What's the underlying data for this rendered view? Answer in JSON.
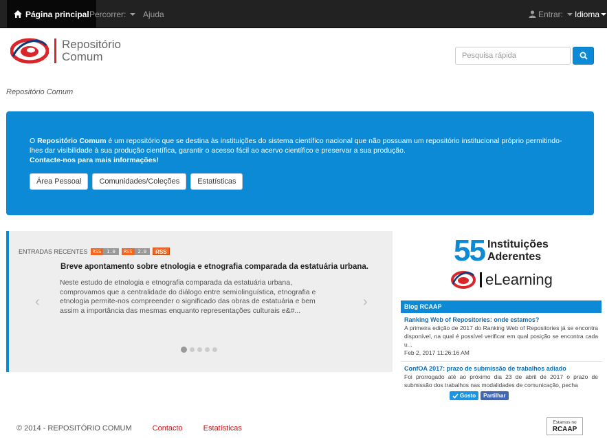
{
  "navbar": {
    "home_label": "Página principal",
    "browse_label": "Percorrer:",
    "help_label": "Ajuda",
    "login_label": "Entrar:",
    "language_label": "Idioma"
  },
  "header": {
    "logo_line1": "Repositório",
    "logo_line2": "Comum",
    "search_placeholder": "Pesquisa rápida"
  },
  "breadcrumb": "Repositório Comum",
  "jumbotron": {
    "intro_prefix": "O ",
    "intro_bold": "Repositório Comum",
    "intro_rest": " é um repositório que se destina às instituições do sistema científico nacional que não possuam um repositório institucional próprio permitindo-lhes dar visibilidade à sua produção científica, garantir o acesso fácil ao acervo científico e preservar a sua produção.",
    "contact": "Contacte-nos para mais informações!",
    "buttons": [
      "Área Pessoal",
      "Comunidades/Coleções",
      "Estatísticas"
    ]
  },
  "recent": {
    "heading": "ENTRADAS RECENTES",
    "rss1_left": "RSS",
    "rss1_right": "1.0",
    "rss2_left": "RSS",
    "rss2_right": "2.0",
    "rss3": "RSS",
    "item_title": "Breve apontamento sobre etnologia e etnografia comparada da estatuária urbana.",
    "item_abstract": "Neste estudo de etnologia e etnografia comparada da estatuária urbana, comprovamos que a centralidade do diálogo entre semiolinguística, etnografia e etnologia permite-nos compreender o significado das obras de estatuária e bem assim a importância das mesmas enquanto representações culturais e&#...",
    "prev_arrow": "‹",
    "next_arrow": "›"
  },
  "promo": {
    "number": "55",
    "line1": "Instituições",
    "line2": "Aderentes",
    "elearning": "eLearning"
  },
  "blog": {
    "title": "Blog RCAAP",
    "items": [
      {
        "title": "Ranking Web of Repositories: onde estamos?",
        "desc": "A primeira edição de 2017 do Ranking Web of Repositories já se encontra disponível, na qual é possível verificar em qual posição se encontra cada u...",
        "date": "Feb 2, 2017 11:26:16 AM"
      },
      {
        "title": "ConfOA 2017: prazo de submissão de trabalhos adiado",
        "desc": "Foi prorrogado até ao próximo dia 23 de abril de 2017 o prazo de submissão dos trabalhos nas modalidades de comunicação, pecha",
        "date": ""
      }
    ],
    "like_label": "Gosto",
    "share_label": "Partilhar"
  },
  "footer": {
    "copyright": "© 2014 - REPOSITÓRIO COMUM",
    "contact": "Contacto",
    "stats": "Estatísticas",
    "badge_small": "Estamos no",
    "badge_big": "RCAAP"
  },
  "colors": {
    "primary": "#0d8ad6",
    "navbar": "#222222",
    "accent_red": "#d9262c",
    "rss_orange": "#f26522"
  }
}
